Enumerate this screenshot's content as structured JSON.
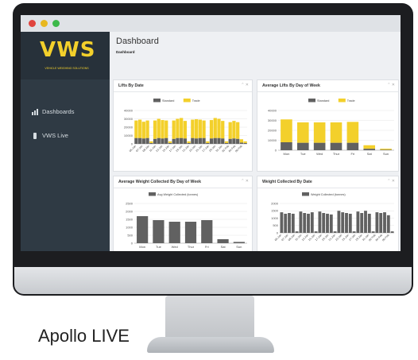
{
  "window": {
    "title": "Dashboard",
    "subtitle": "Dashboard"
  },
  "brand": {
    "logo": "VWS",
    "tagline": "VEHICLE WEIGHING SOLUTIONS",
    "accent": "#f3d02b",
    "dark": "#616161"
  },
  "sidebar": {
    "items": [
      {
        "label": "Dashboards",
        "icon": "bar-chart-icon"
      },
      {
        "label": "VWS Live",
        "icon": "phone-icon"
      }
    ]
  },
  "panels": {
    "p1": {
      "title": "Lifts By Date"
    },
    "p2": {
      "title": "Average Lifts By Day of Week"
    },
    "p3": {
      "title": "Average Weight Collected By Day of Week"
    },
    "p4": {
      "title": "Weight Collected By Date"
    }
  },
  "caption": "Apollo LIVE",
  "chart_data": [
    {
      "type": "bar",
      "title": "Lifts By Date",
      "series": [
        {
          "name": "Standard",
          "values": [
            7000,
            7000,
            6500,
            7000,
            1000,
            6000,
            7000,
            6500,
            7000,
            1000,
            6000,
            7000,
            7000,
            6500,
            1000,
            7000,
            6500,
            7000,
            7000,
            1000,
            6500,
            7000,
            7000,
            6500,
            1000,
            6000,
            6500,
            6000,
            1500,
            1000
          ]
        },
        {
          "name": "Trade",
          "values": [
            21000,
            22000,
            20000,
            21000,
            2000,
            22000,
            23000,
            22000,
            21000,
            2000,
            22000,
            23000,
            24000,
            21000,
            2000,
            22000,
            23000,
            22000,
            21000,
            2000,
            22000,
            24000,
            23000,
            21000,
            2000,
            20000,
            21000,
            20000,
            4000,
            2000
          ]
        }
      ],
      "ticks": [
        "05-Jan",
        "07-Jan",
        "09-Jan",
        "11-Jan",
        "13-Jan",
        "15-Jan",
        "17-Jan",
        "19-Jan",
        "21-Jan",
        "23-Jan",
        "25-Jan",
        "27-Jan",
        "29-Jan",
        "31-Jan",
        "02-Feb",
        "04-Feb",
        "06-Feb"
      ],
      "yticks": [
        "0",
        "10000",
        "20000",
        "30000",
        "40000"
      ],
      "ylim": [
        0,
        40000
      ]
    },
    {
      "type": "bar",
      "title": "Average Lifts By Day of Week",
      "categories": [
        "Mon",
        "Tue",
        "Wed",
        "Thur",
        "Fri",
        "Sat",
        "Sun"
      ],
      "series": [
        {
          "name": "Standard",
          "values": [
            8000,
            7500,
            7500,
            7500,
            7500,
            1500,
            500
          ]
        },
        {
          "name": "Trade",
          "values": [
            23000,
            20500,
            20500,
            20500,
            21000,
            3500,
            1000
          ]
        }
      ],
      "yticks": [
        "0",
        "10000",
        "20000",
        "30000",
        "40000"
      ],
      "ylim": [
        0,
        40000
      ]
    },
    {
      "type": "bar",
      "title": "Average Weight Collected By Day of Week",
      "categories": [
        "Mon",
        "Tue",
        "Wed",
        "Thur",
        "Fri",
        "Sat",
        "Sun"
      ],
      "series": [
        {
          "name": "Avg Weight Collected (tonnes)",
          "values": [
            1700,
            1450,
            1350,
            1350,
            1450,
            250,
            80
          ]
        }
      ],
      "yticks": [
        "0",
        "500",
        "1000",
        "1500",
        "2000",
        "2500"
      ],
      "ylim": [
        0,
        2500
      ]
    },
    {
      "type": "bar",
      "title": "Weight Collected By Date",
      "series": [
        {
          "name": "Weight Collected (tonnes)",
          "values": [
            1400,
            1300,
            1350,
            1300,
            100,
            1450,
            1350,
            1300,
            1400,
            100,
            1450,
            1350,
            1300,
            1250,
            100,
            1500,
            1400,
            1350,
            1300,
            100,
            1450,
            1350,
            1500,
            1300,
            100,
            1400,
            1350,
            1400,
            1200,
            100
          ]
        }
      ],
      "ticks": [
        "05-Jan",
        "07-Jan",
        "09-Jan",
        "11-Jan",
        "13-Jan",
        "15-Jan",
        "17-Jan",
        "19-Jan",
        "21-Jan",
        "23-Jan",
        "25-Jan",
        "27-Jan",
        "29-Jan",
        "31-Jan",
        "02-Feb",
        "04-Feb",
        "06-Feb"
      ],
      "yticks": [
        "0",
        "500",
        "1000",
        "1500",
        "2000"
      ],
      "ylim": [
        0,
        2000
      ]
    }
  ]
}
